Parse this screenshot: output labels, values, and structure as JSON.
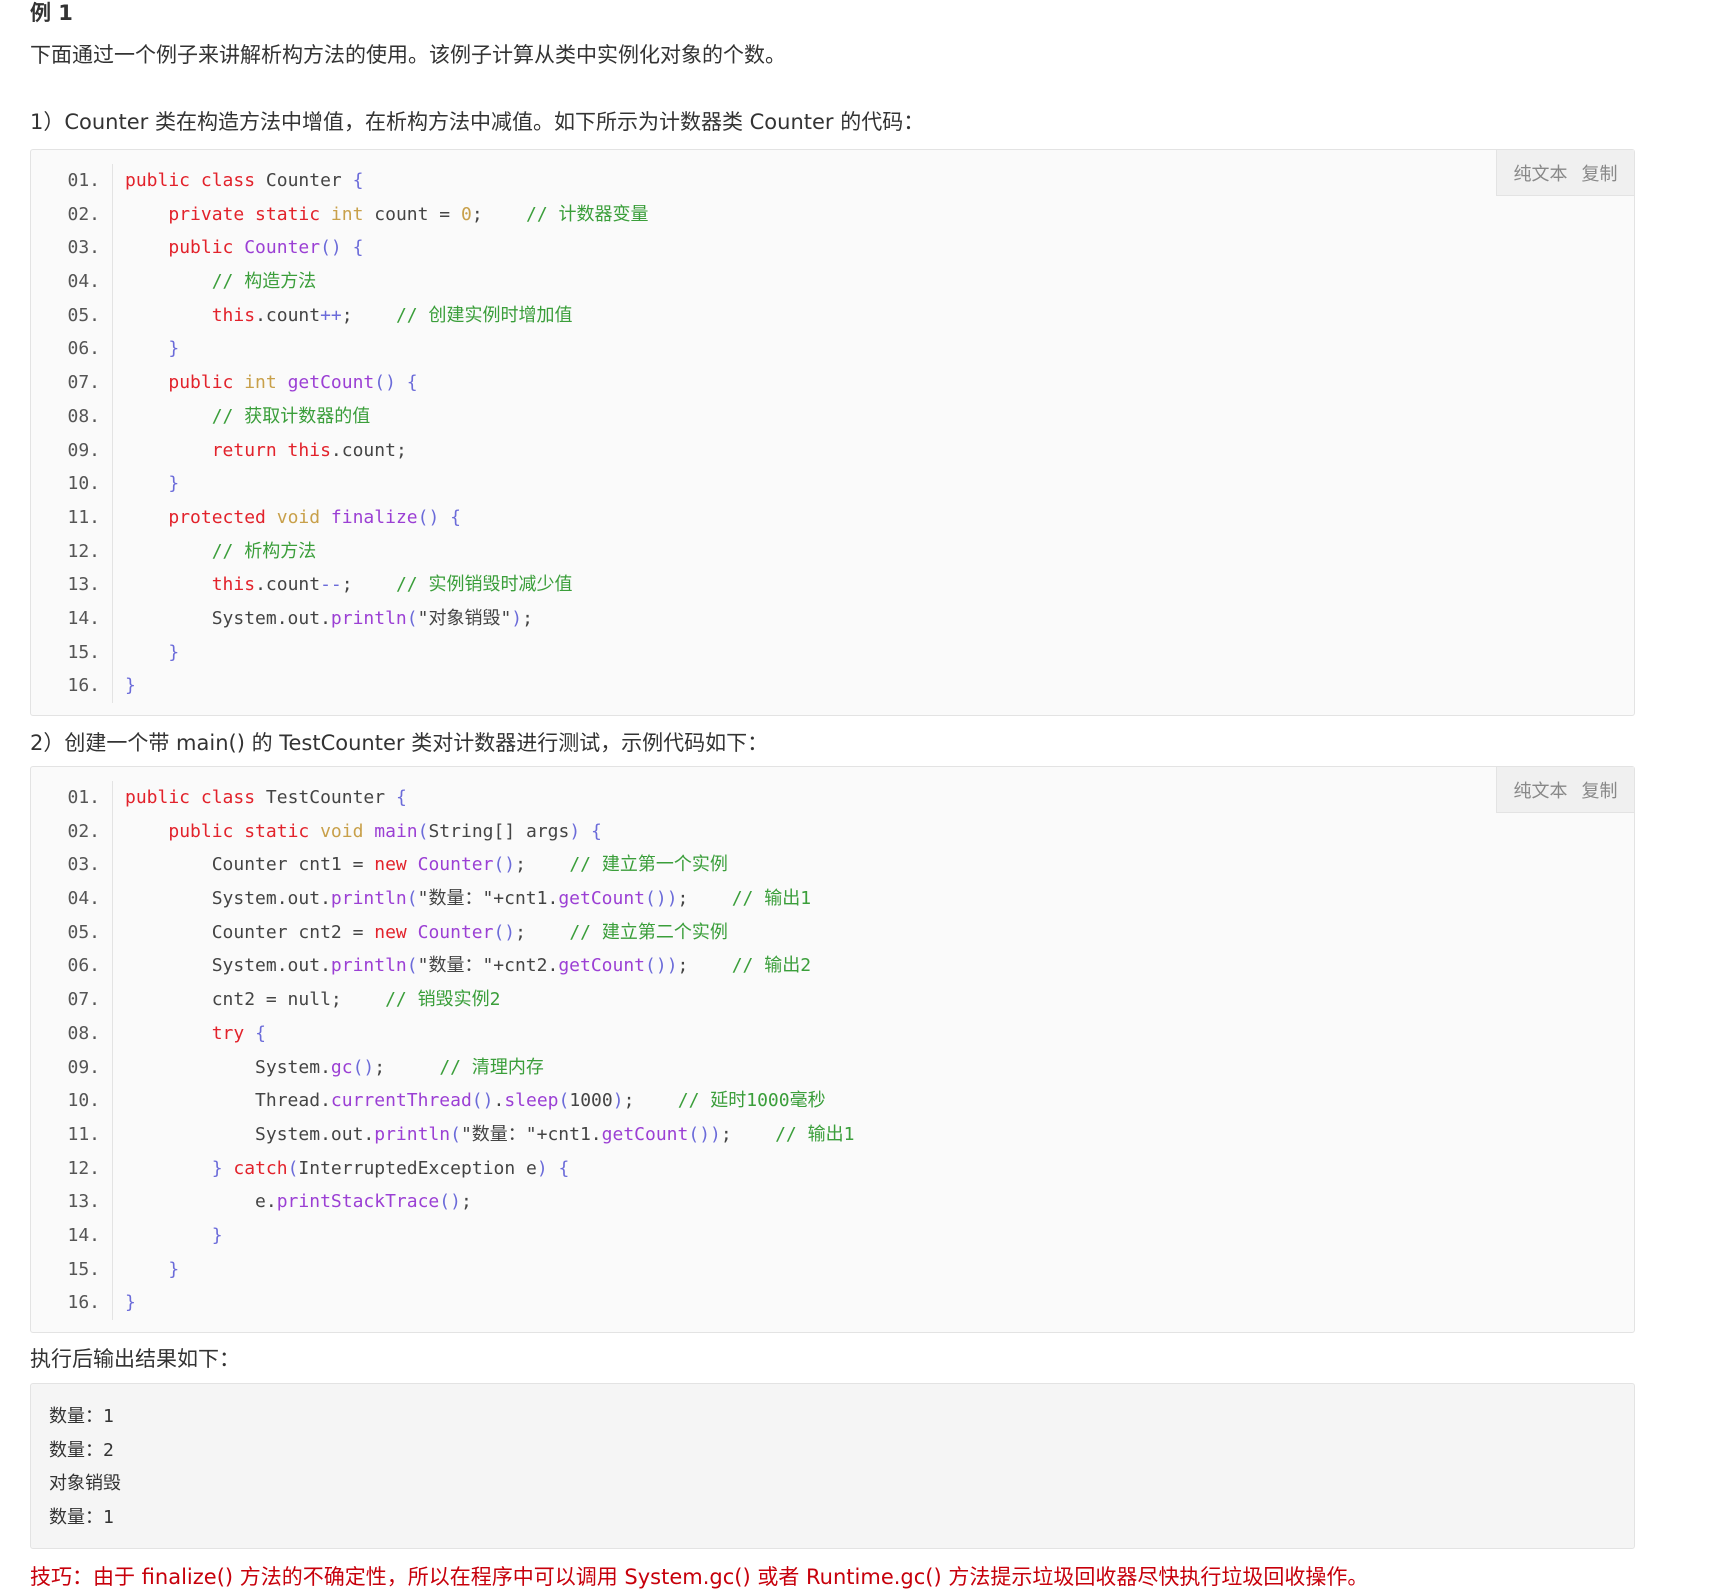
{
  "heading": "例 1",
  "intro": "下面通过一个例子来讲解析构方法的使用。该例子计算从类中实例化对象的个数。",
  "step1": "1）Counter 类在构造方法中增值，在析构方法中减值。如下所示为计数器类 Counter 的代码：",
  "step2": "2）创建一个带 main() 的 TestCounter 类对计数器进行测试，示例代码如下：",
  "output_label": "执行后输出结果如下：",
  "toolbar": {
    "plain_text": "纯文本",
    "copy": "复制"
  },
  "code1": [
    [
      [
        "kw",
        "public class "
      ],
      [
        "st",
        "Counter "
      ],
      [
        "pu",
        "{"
      ]
    ],
    [
      [
        "st",
        "    "
      ],
      [
        "kw",
        "private static "
      ],
      [
        "ty",
        "int "
      ],
      [
        "st",
        "count = "
      ],
      [
        "ty",
        "0"
      ],
      [
        "st",
        ";    "
      ],
      [
        "cm",
        "// 计数器变量"
      ]
    ],
    [
      [
        "st",
        "    "
      ],
      [
        "kw",
        "public "
      ],
      [
        "fn",
        "Counter"
      ],
      [
        "pu",
        "() {"
      ]
    ],
    [
      [
        "st",
        "        "
      ],
      [
        "cm",
        "// 构造方法"
      ]
    ],
    [
      [
        "st",
        "        "
      ],
      [
        "kw",
        "this"
      ],
      [
        "st",
        ".count"
      ],
      [
        "pu",
        "++"
      ],
      [
        "st",
        ";    "
      ],
      [
        "cm",
        "// 创建实例时增加值"
      ]
    ],
    [
      [
        "st",
        "    "
      ],
      [
        "pu",
        "}"
      ]
    ],
    [
      [
        "st",
        "    "
      ],
      [
        "kw",
        "public "
      ],
      [
        "ty",
        "int "
      ],
      [
        "fn",
        "getCount"
      ],
      [
        "pu",
        "() {"
      ]
    ],
    [
      [
        "st",
        "        "
      ],
      [
        "cm",
        "// 获取计数器的值"
      ]
    ],
    [
      [
        "st",
        "        "
      ],
      [
        "kw",
        "return this"
      ],
      [
        "st",
        ".count;"
      ]
    ],
    [
      [
        "st",
        "    "
      ],
      [
        "pu",
        "}"
      ]
    ],
    [
      [
        "st",
        "    "
      ],
      [
        "kw",
        "protected "
      ],
      [
        "ty",
        "void "
      ],
      [
        "fn",
        "finalize"
      ],
      [
        "pu",
        "() {"
      ]
    ],
    [
      [
        "st",
        "        "
      ],
      [
        "cm",
        "// 析构方法"
      ]
    ],
    [
      [
        "st",
        "        "
      ],
      [
        "kw",
        "this"
      ],
      [
        "st",
        ".count"
      ],
      [
        "pu",
        "--"
      ],
      [
        "st",
        ";    "
      ],
      [
        "cm",
        "// 实例销毁时减少值"
      ]
    ],
    [
      [
        "st",
        "        System.out."
      ],
      [
        "fn",
        "println"
      ],
      [
        "pu",
        "("
      ],
      [
        "st",
        "\"对象销毁\""
      ],
      [
        "pu",
        ")"
      ],
      [
        "st",
        ";"
      ]
    ],
    [
      [
        "st",
        "    "
      ],
      [
        "pu",
        "}"
      ]
    ],
    [
      [
        "pu",
        "}"
      ]
    ]
  ],
  "code2": [
    [
      [
        "kw",
        "public class "
      ],
      [
        "st",
        "TestCounter "
      ],
      [
        "pu",
        "{"
      ]
    ],
    [
      [
        "st",
        "    "
      ],
      [
        "kw",
        "public static "
      ],
      [
        "ty",
        "void "
      ],
      [
        "fn",
        "main"
      ],
      [
        "pu",
        "("
      ],
      [
        "st",
        "String[] args"
      ],
      [
        "pu",
        ") {"
      ]
    ],
    [
      [
        "st",
        "        Counter cnt1 = "
      ],
      [
        "kw",
        "new "
      ],
      [
        "fn",
        "Counter"
      ],
      [
        "pu",
        "()"
      ],
      [
        "st",
        ";    "
      ],
      [
        "cm",
        "// 建立第一个实例"
      ]
    ],
    [
      [
        "st",
        "        System.out."
      ],
      [
        "fn",
        "println"
      ],
      [
        "pu",
        "("
      ],
      [
        "st",
        "\"数量：\"+cnt1."
      ],
      [
        "fn",
        "getCount"
      ],
      [
        "pu",
        "())"
      ],
      [
        "st",
        ";    "
      ],
      [
        "cm",
        "// 输出1"
      ]
    ],
    [
      [
        "st",
        "        Counter cnt2 = "
      ],
      [
        "kw",
        "new "
      ],
      [
        "fn",
        "Counter"
      ],
      [
        "pu",
        "()"
      ],
      [
        "st",
        ";    "
      ],
      [
        "cm",
        "// 建立第二个实例"
      ]
    ],
    [
      [
        "st",
        "        System.out."
      ],
      [
        "fn",
        "println"
      ],
      [
        "pu",
        "("
      ],
      [
        "st",
        "\"数量：\"+cnt2."
      ],
      [
        "fn",
        "getCount"
      ],
      [
        "pu",
        "())"
      ],
      [
        "st",
        ";    "
      ],
      [
        "cm",
        "// 输出2"
      ]
    ],
    [
      [
        "st",
        "        cnt2 = null;    "
      ],
      [
        "cm",
        "// 销毁实例2"
      ]
    ],
    [
      [
        "st",
        "        "
      ],
      [
        "kw",
        "try "
      ],
      [
        "pu",
        "{"
      ]
    ],
    [
      [
        "st",
        "            System."
      ],
      [
        "fn",
        "gc"
      ],
      [
        "pu",
        "()"
      ],
      [
        "st",
        ";     "
      ],
      [
        "cm",
        "// 清理内存"
      ]
    ],
    [
      [
        "st",
        "            Thread."
      ],
      [
        "fn",
        "currentThread"
      ],
      [
        "pu",
        "()"
      ],
      [
        "st",
        "."
      ],
      [
        "fn",
        "sleep"
      ],
      [
        "pu",
        "("
      ],
      [
        "st",
        "1000"
      ],
      [
        "pu",
        ")"
      ],
      [
        "st",
        ";    "
      ],
      [
        "cm",
        "// 延时1000毫秒"
      ]
    ],
    [
      [
        "st",
        "            System.out."
      ],
      [
        "fn",
        "println"
      ],
      [
        "pu",
        "("
      ],
      [
        "st",
        "\"数量：\"+cnt1."
      ],
      [
        "fn",
        "getCount"
      ],
      [
        "pu",
        "())"
      ],
      [
        "st",
        ";    "
      ],
      [
        "cm",
        "// 输出1"
      ]
    ],
    [
      [
        "st",
        "        "
      ],
      [
        "pu",
        "} "
      ],
      [
        "kw",
        "catch"
      ],
      [
        "pu",
        "("
      ],
      [
        "st",
        "InterruptedException e"
      ],
      [
        "pu",
        ") {"
      ]
    ],
    [
      [
        "st",
        "            e."
      ],
      [
        "fn",
        "printStackTrace"
      ],
      [
        "pu",
        "()"
      ],
      [
        "st",
        ";"
      ]
    ],
    [
      [
        "st",
        "        "
      ],
      [
        "pu",
        "}"
      ]
    ],
    [
      [
        "st",
        "    "
      ],
      [
        "pu",
        "}"
      ]
    ],
    [
      [
        "pu",
        "}"
      ]
    ]
  ],
  "output_lines": [
    "数量：1",
    "数量：2",
    "对象销毁",
    "数量：1"
  ],
  "tip": "技巧：由于 finalize() 方法的不确定性，所以在程序中可以调用 System.gc() 或者 Runtime.gc() 方法提示垃圾回收器尽快执行垃圾回收操作。"
}
